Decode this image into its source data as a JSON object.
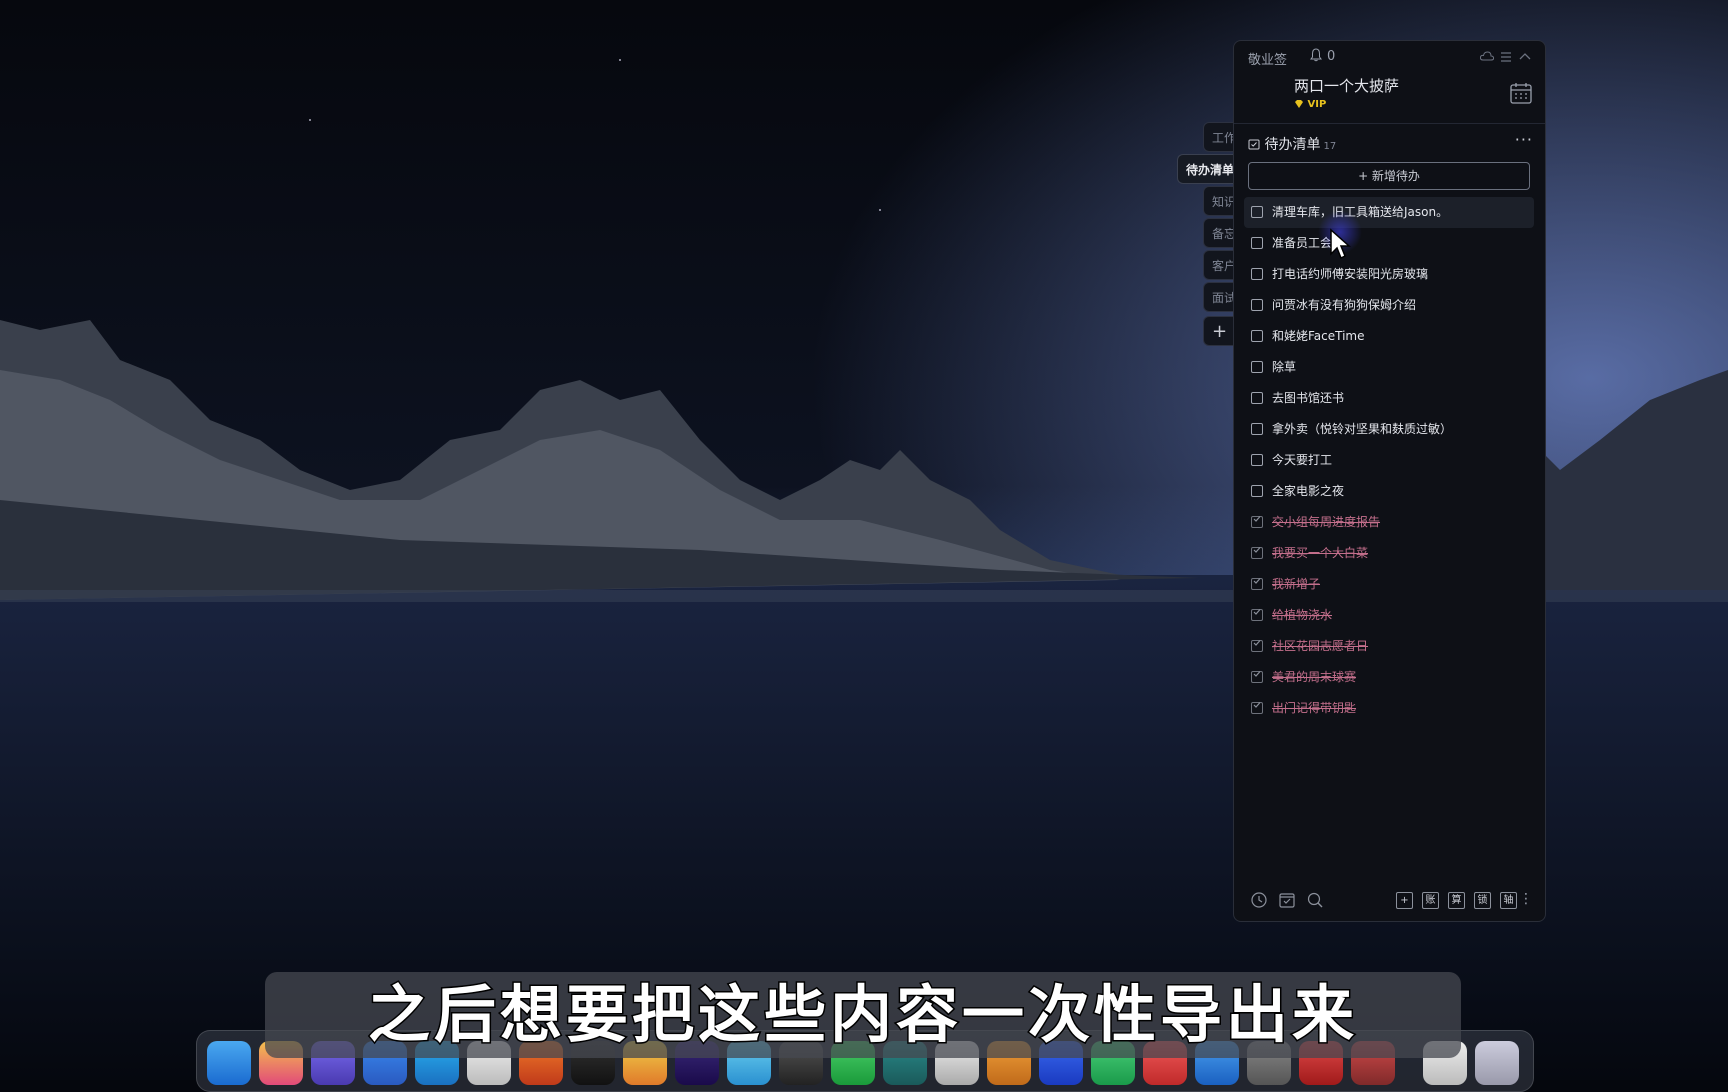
{
  "app": {
    "name": "敬业签",
    "notification_count": "0"
  },
  "user": {
    "name": "两口一个大披萨",
    "badge": "VIP"
  },
  "side_tabs": [
    {
      "label": "工作"
    },
    {
      "label": "待办清单"
    },
    {
      "label": "知识"
    },
    {
      "label": "备忘"
    },
    {
      "label": "客户"
    },
    {
      "label": "面试"
    },
    {
      "label": "+"
    }
  ],
  "list": {
    "title": "待办清单",
    "count": "17",
    "more": "···",
    "add_button": "+ 新增待办"
  },
  "todos": [
    {
      "text": "清理车库，旧工具箱送给Jason。",
      "done": false
    },
    {
      "text": "准备员工会",
      "done": false
    },
    {
      "text": "打电话约师傅安装阳光房玻璃",
      "done": false
    },
    {
      "text": "问贾冰有没有狗狗保姆介绍",
      "done": false
    },
    {
      "text": "和姥姥FaceTime",
      "done": false
    },
    {
      "text": "除草",
      "done": false
    },
    {
      "text": "去图书馆还书",
      "done": false
    },
    {
      "text": "拿外卖（悦铃对坚果和麸质过敏）",
      "done": false
    },
    {
      "text": "今天要打工",
      "done": false
    },
    {
      "text": "全家电影之夜",
      "done": false
    },
    {
      "text": "交小组每周进度报告",
      "done": true
    },
    {
      "text": "我要买一个大白菜",
      "done": true
    },
    {
      "text": "我新增子",
      "done": true
    },
    {
      "text": "给植物浇水",
      "done": true
    },
    {
      "text": "社区花园志愿者日",
      "done": true
    },
    {
      "text": "美君的周末球赛",
      "done": true
    },
    {
      "text": "出门记得带钥匙",
      "done": true
    }
  ],
  "bottom_bar": {
    "icons": [
      "history-icon",
      "checklist-icon",
      "search-icon"
    ],
    "tools": [
      "+",
      "账",
      "算",
      "锁",
      "轴"
    ],
    "more": "⋮"
  },
  "subtitle": "之后想要把这些内容一次性导出来",
  "colors": {
    "panel_bg": "#0e1016",
    "done_text": "#c46f8c",
    "vip": "#e8c21e"
  }
}
